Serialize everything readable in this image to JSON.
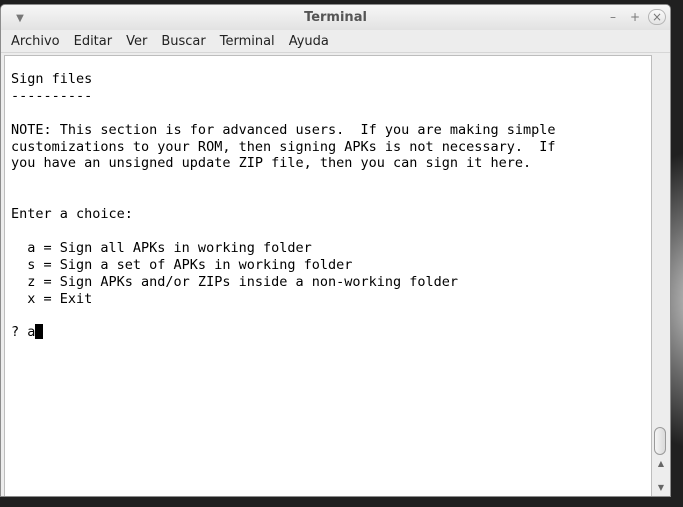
{
  "window": {
    "title": "Terminal",
    "menu_icon": "chevron-down-icon",
    "controls": {
      "minimize": "–",
      "maximize": "+",
      "close": "×"
    }
  },
  "menubar": {
    "items": [
      {
        "label": "Archivo"
      },
      {
        "label": "Editar"
      },
      {
        "label": "Ver"
      },
      {
        "label": "Buscar"
      },
      {
        "label": "Terminal"
      },
      {
        "label": "Ayuda"
      }
    ]
  },
  "terminal": {
    "lines": [
      "Sign files",
      "----------",
      "",
      "NOTE: This section is for advanced users.  If you are making simple",
      "customizations to your ROM, then signing APKs is not necessary.  If",
      "you have an unsigned update ZIP file, then you can sign it here.",
      "",
      "",
      "Enter a choice:",
      "",
      "  a = Sign all APKs in working folder",
      "  s = Sign a set of APKs in working folder",
      "  z = Sign APKs and/or ZIPs inside a non-working folder",
      "  x = Exit",
      ""
    ],
    "prompt": "? a"
  },
  "scrollbar": {
    "up_arrow": "▲",
    "down_arrow": "▼"
  }
}
